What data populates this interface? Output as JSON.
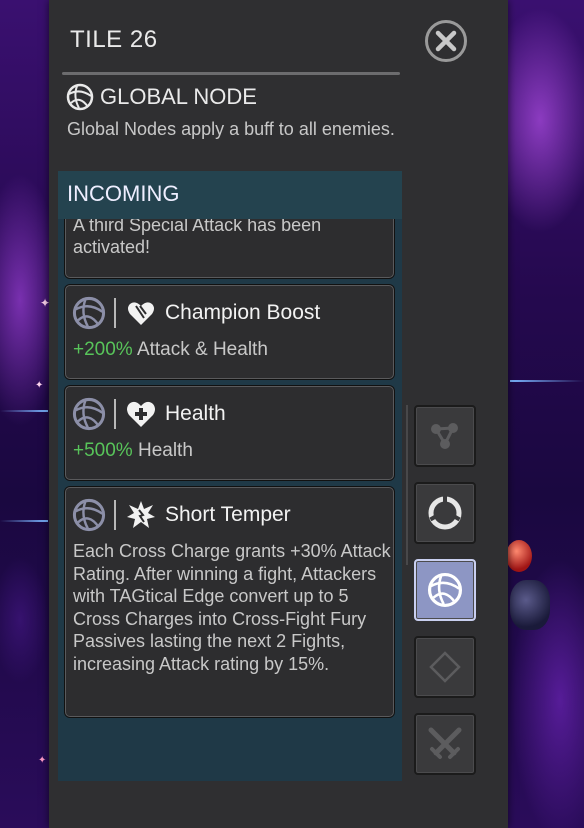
{
  "panel": {
    "title": "TILE 26",
    "close_icon": "close-icon",
    "node_icon": "global-node-icon",
    "node_title": "GLOBAL NODE",
    "node_desc": "Global Nodes apply a buff to all enemies."
  },
  "incoming": {
    "header": "INCOMING",
    "cards": [
      {
        "cut_text": "A third Special Attack has been activated!"
      },
      {
        "node_icon": "global-node-icon",
        "buff_icon": "champion-boost-icon",
        "title": "Champion Boost",
        "value": "+200%",
        "stat": "Attack & Health"
      },
      {
        "node_icon": "global-node-icon",
        "buff_icon": "health-cross-icon",
        "title": "Health",
        "value": "+500%",
        "stat": "Health"
      },
      {
        "node_icon": "global-node-icon",
        "buff_icon": "short-temper-icon",
        "title": "Short Temper",
        "body": "Each Cross Charge grants +30% Attack Rating. After winning a fight, Attackers with TAGtical Edge convert up to 5 Cross Charges into Cross-Fight Fury Passives lasting the next 2 Fights, increasing Attack rating by 15%."
      }
    ]
  },
  "side_buttons": [
    {
      "icon": "path-nodes-icon",
      "active": false
    },
    {
      "icon": "ring-target-icon",
      "active": false
    },
    {
      "icon": "global-node-icon",
      "active": true
    },
    {
      "icon": "diamond-icon",
      "active": false
    },
    {
      "icon": "crossed-swords-icon",
      "active": false
    }
  ],
  "colors": {
    "panel_bg": "#2f2f31",
    "incoming_bg": "#1f3947",
    "positive_value": "#58c45a",
    "active_button": "#8d96c4"
  }
}
